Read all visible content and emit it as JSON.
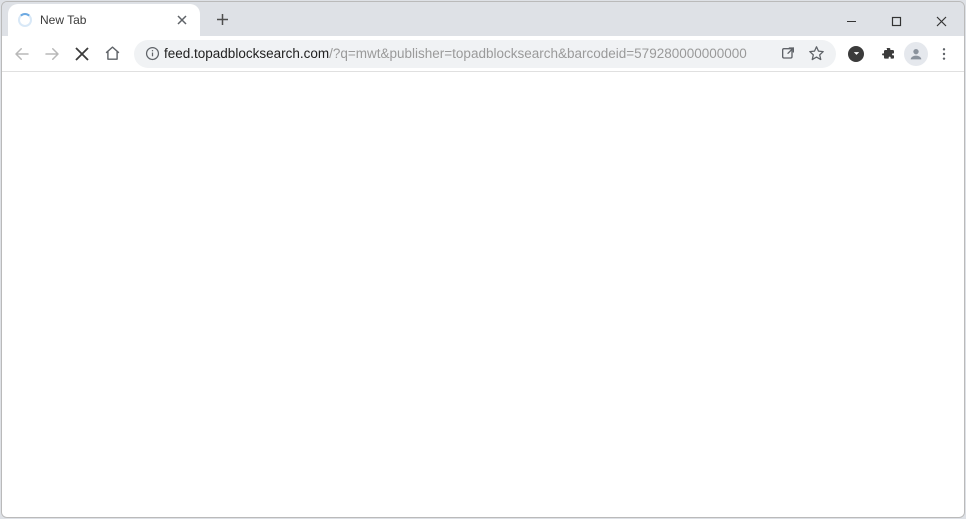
{
  "tab": {
    "title": "New Tab"
  },
  "url": {
    "host": "feed.topadblocksearch.com",
    "path": "/?q=mwt&publisher=topadblocksearch&barcodeid=579280000000000"
  }
}
